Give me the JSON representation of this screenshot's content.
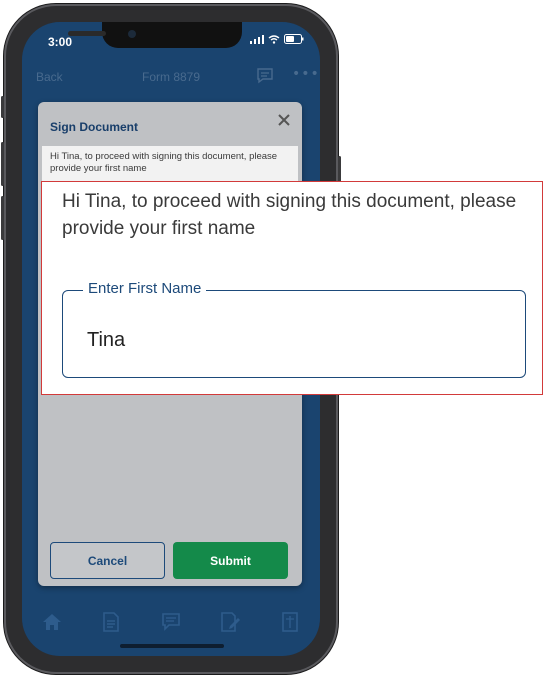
{
  "status_bar": {
    "time": "3:00"
  },
  "nav": {
    "back_label": "Back",
    "title": "Form 8879"
  },
  "modal": {
    "title": "Sign Document",
    "message": "Hi Tina, to proceed with signing this document, please provide your first name",
    "cancel_label": "Cancel",
    "submit_label": "Submit"
  },
  "callout": {
    "message": "Hi Tina, to proceed with signing this document, please provide your first name",
    "field_label": "Enter First Name",
    "field_value": "Tina"
  },
  "tab_bar": {
    "tabs": [
      "home-icon",
      "document-icon",
      "message-icon",
      "sign-icon",
      "form-icon"
    ]
  },
  "colors": {
    "primary_blue": "#1d4a7a",
    "submit_green": "#148a4a",
    "callout_border": "#d23a3a"
  }
}
